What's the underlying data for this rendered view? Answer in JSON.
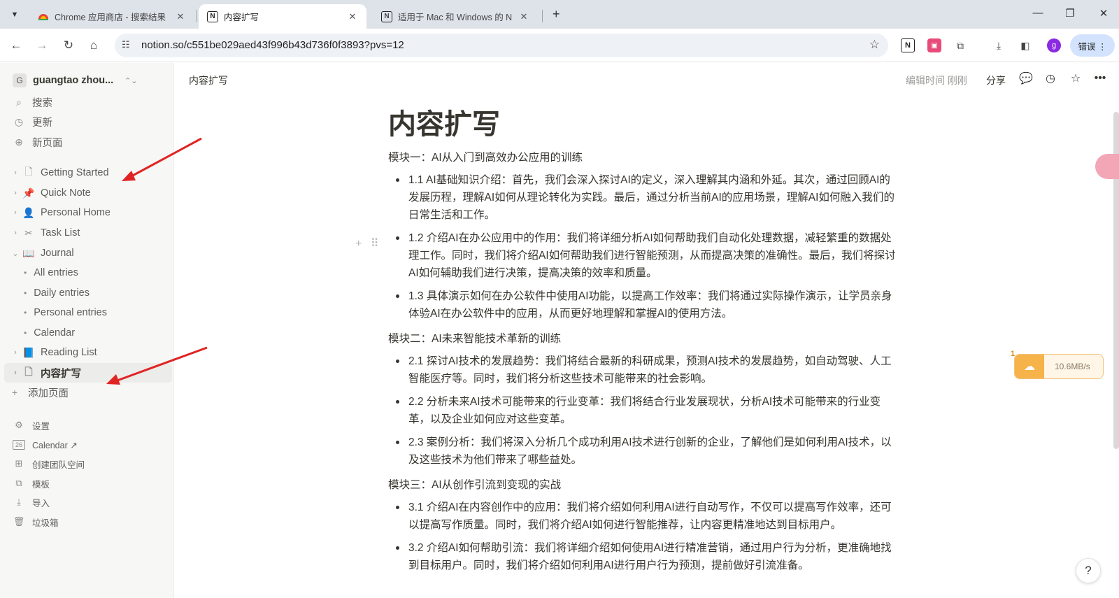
{
  "browser": {
    "tabs": [
      {
        "title": "Chrome 应用商店 - 搜索结果",
        "close": "✕"
      },
      {
        "title": "内容扩写",
        "close": "✕"
      },
      {
        "title": "适用于 Mac 和 Windows 的 N",
        "close": "✕"
      }
    ],
    "new_tab": "+",
    "window_controls": {
      "minimize": "—",
      "restore": "❐",
      "close": "✕"
    },
    "url": "notion.so/c551be029aed43f996b43d736f0f3893?pvs=12",
    "profile_initial": "g",
    "error_chip": "错误 ⋮"
  },
  "sidebar": {
    "workspace": {
      "avatar": "G",
      "name": "guangtao zhou...",
      "caret": "⌃⌄"
    },
    "actions": [
      {
        "label": "搜索",
        "icon": "search-icon"
      },
      {
        "label": "更新",
        "icon": "clock-icon"
      },
      {
        "label": "新页面",
        "icon": "plus-circle-icon"
      }
    ],
    "pages": [
      {
        "label": "Getting Started",
        "icon": "page-icon"
      },
      {
        "label": "Quick Note",
        "icon": "pin-icon"
      },
      {
        "label": "Personal Home",
        "icon": "person-icon"
      },
      {
        "label": "Task List",
        "icon": "scissors-icon"
      },
      {
        "label": "Journal",
        "icon": "book-icon"
      }
    ],
    "journal_children": [
      "All entries",
      "Daily entries",
      "Personal entries",
      "Calendar"
    ],
    "pages_after": [
      {
        "label": "Reading List",
        "icon": "book-icon"
      },
      {
        "label": "内容扩写",
        "icon": "page-icon"
      }
    ],
    "add_page": "添加页面",
    "bottom": [
      {
        "label": "设置",
        "icon": "gear-icon"
      },
      {
        "label": "Calendar ↗",
        "icon": "calendar-icon",
        "badge": "26"
      },
      {
        "label": "创建团队空间",
        "icon": "team-icon"
      },
      {
        "label": "模板",
        "icon": "template-icon"
      },
      {
        "label": "导入",
        "icon": "download-icon"
      },
      {
        "label": "垃圾箱",
        "icon": "trash-icon"
      }
    ]
  },
  "topbar": {
    "breadcrumb": "内容扩写",
    "edited": "编辑时间 刚刚",
    "share": "分享"
  },
  "page": {
    "title": "内容扩写",
    "sections": [
      {
        "heading": "模块一：AI从入门到高效办公应用的训练",
        "bullets": [
          "1.1 AI基础知识介绍：首先，我们会深入探讨AI的定义，深入理解其内涵和外延。其次，通过回顾AI的发展历程，理解AI如何从理论转化为实践。最后，通过分析当前AI的应用场景，理解AI如何融入我们的日常生活和工作。",
          "1.2 介绍AI在办公应用中的作用：我们将详细分析AI如何帮助我们自动化处理数据，减轻繁重的数据处理工作。同时，我们将介绍AI如何帮助我们进行智能预测，从而提高决策的准确性。最后，我们将探讨AI如何辅助我们进行决策，提高决策的效率和质量。",
          "1.3 具体演示如何在办公软件中使用AI功能，以提高工作效率：我们将通过实际操作演示，让学员亲身体验AI在办公软件中的应用，从而更好地理解和掌握AI的使用方法。"
        ]
      },
      {
        "heading": "模块二：AI未来智能技术革新的训练",
        "bullets": [
          "2.1 探讨AI技术的发展趋势：我们将结合最新的科研成果，预测AI技术的发展趋势，如自动驾驶、人工智能医疗等。同时，我们将分析这些技术可能带来的社会影响。",
          "2.2 分析未来AI技术可能带来的行业变革：我们将结合行业发展现状，分析AI技术可能带来的行业变革，以及企业如何应对这些变革。",
          "2.3 案例分析：我们将深入分析几个成功利用AI技术进行创新的企业，了解他们是如何利用AI技术，以及这些技术为他们带来了哪些益处。"
        ]
      },
      {
        "heading": "模块三：AI从创作引流到变现的实战",
        "bullets": [
          "3.1 介绍AI在内容创作中的应用：我们将介绍如何利用AI进行自动写作，不仅可以提高写作效率，还可以提高写作质量。同时，我们将介绍AI如何进行智能推荐，让内容更精准地达到目标用户。",
          "3.2 介绍AI如何帮助引流：我们将详细介绍如何使用AI进行精准营销，通过用户行为分析，更准确地找到目标用户。同时，我们将介绍如何利用AI进行用户行为预测，提前做好引流准备。"
        ]
      }
    ]
  },
  "overlay": {
    "speed_badge": "1",
    "speed_value": "10.6MB/s",
    "help": "?"
  },
  "colors": {
    "tabstrip": "#dee3ea",
    "sidebar": "#f7f7f5",
    "arrow": "#e02424",
    "text": "#37352f"
  }
}
